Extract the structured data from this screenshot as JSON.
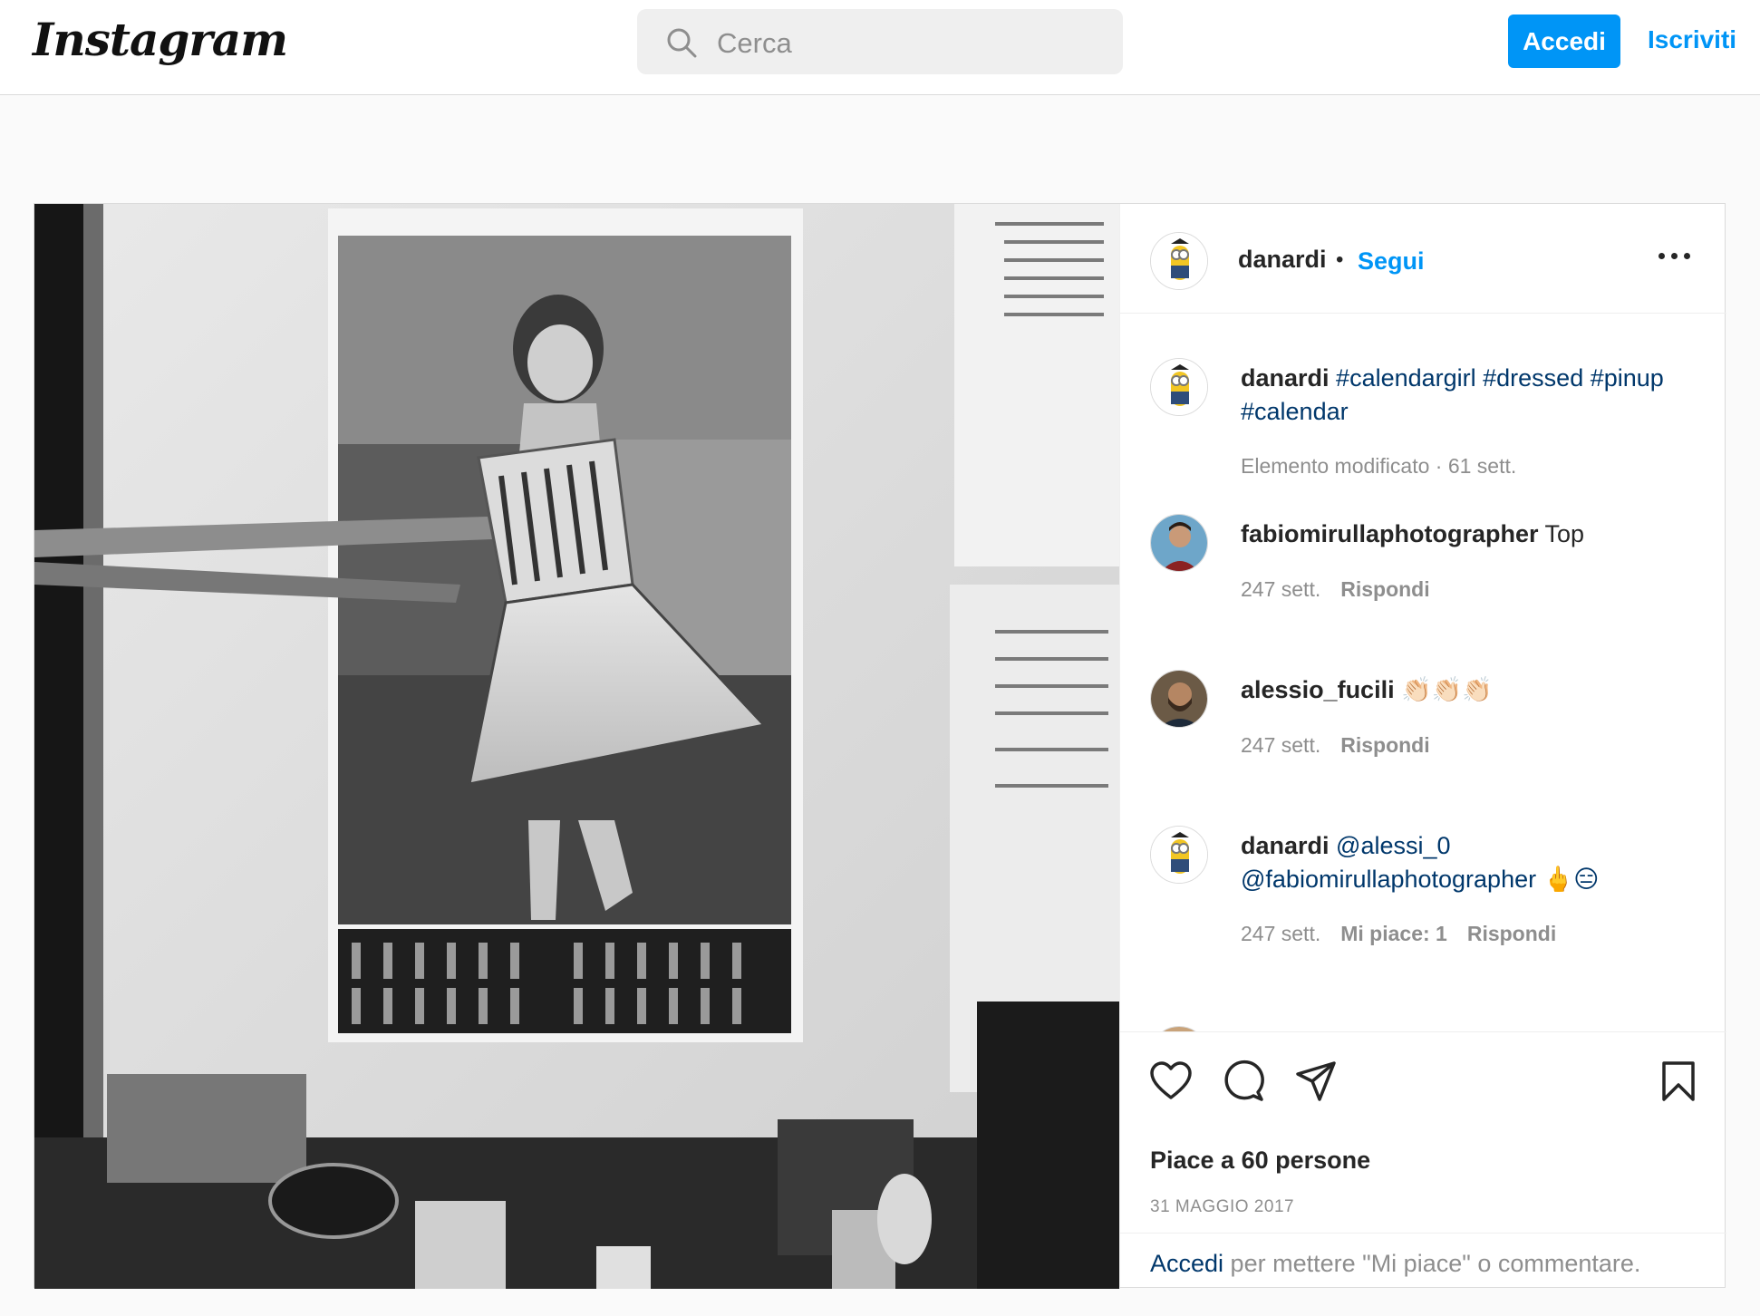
{
  "header": {
    "logo": "Instagram",
    "search_placeholder": "Cerca",
    "login_label": "Accedi",
    "signup_label": "Iscriviti"
  },
  "post": {
    "author": "danardi",
    "separator": "•",
    "follow_label": "Segui",
    "caption": {
      "username": "danardi",
      "text": "#calendargirl #dressed #pinup #calendar",
      "meta": "Elemento modificato · 61 sett."
    },
    "comments": [
      {
        "username": "fabiomirullaphotographer",
        "text": "Top",
        "time": "247 sett.",
        "likes": "",
        "reply": "Rispondi"
      },
      {
        "username": "alessio_fucili",
        "text": "👏🏻👏🏻👏🏻",
        "time": "247 sett.",
        "likes": "",
        "reply": "Rispondi"
      },
      {
        "username": "danardi",
        "text": "@alessi_0 @fabiomirullaphotographer 🖕😑",
        "time": "247 sett.",
        "likes": "Mi piace: 1",
        "reply": "Rispondi"
      }
    ],
    "likes_text": "Piace a 60 persone",
    "date": "31 MAGGIO 2017",
    "login_prompt": {
      "link": "Accedi",
      "text": " per mettere \"Mi piace\" o commentare."
    }
  },
  "icons": [
    "search-icon",
    "more-options-icon",
    "heart-icon",
    "comment-icon",
    "share-icon",
    "bookmark-icon"
  ],
  "colors": {
    "accent": "#0095f6",
    "link": "#00376b",
    "muted": "#8e8e8e",
    "text": "#262626"
  }
}
